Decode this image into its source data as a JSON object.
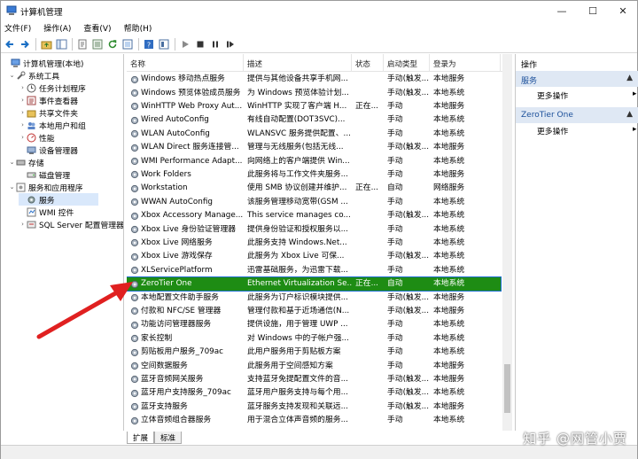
{
  "window": {
    "title": "计算机管理",
    "min_glyph": "—",
    "max_glyph": "☐",
    "close_glyph": "✕"
  },
  "menu": [
    "文件(F)",
    "操作(A)",
    "查看(V)",
    "帮助(H)"
  ],
  "tree": {
    "root": "计算机管理(本地)",
    "system_tools": "系统工具",
    "task_scheduler": "任务计划程序",
    "event_viewer": "事件查看器",
    "shared_folders": "共享文件夹",
    "local_users": "本地用户和组",
    "performance": "性能",
    "device_manager": "设备管理器",
    "storage": "存储",
    "disk_management": "磁盘管理",
    "services_apps": "服务和应用程序",
    "services": "服务",
    "wmi": "WMI 控件",
    "sql": "SQL Server 配置管理器"
  },
  "columns": {
    "name": "名称",
    "desc": "描述",
    "status": "状态",
    "startup": "启动类型",
    "logon": "登录为"
  },
  "rows": [
    {
      "name": "Windows 移动热点服务",
      "desc": "提供与其他设备共享手机网...",
      "status": "",
      "startup": "手动(触发...",
      "logon": "本地服务"
    },
    {
      "name": "Windows 预览体验成员服务",
      "desc": "为 Windows 预览体验计划...",
      "status": "",
      "startup": "手动(触发...",
      "logon": "本地系统"
    },
    {
      "name": "WinHTTP Web Proxy Aut...",
      "desc": "WinHTTP 实现了客户端 H...",
      "status": "正在...",
      "startup": "手动",
      "logon": "本地服务"
    },
    {
      "name": "Wired AutoConfig",
      "desc": "有线自动配置(DOT3SVC)...",
      "status": "",
      "startup": "手动",
      "logon": "本地系统"
    },
    {
      "name": "WLAN AutoConfig",
      "desc": "WLANSVC 服务提供配置、...",
      "status": "",
      "startup": "手动",
      "logon": "本地系统"
    },
    {
      "name": "WLAN Direct 服务连接管...",
      "desc": "管理与无线服务(包括无线...",
      "status": "",
      "startup": "手动(触发...",
      "logon": "本地服务"
    },
    {
      "name": "WMI Performance Adapt...",
      "desc": "向网络上的客户端提供 Win...",
      "status": "",
      "startup": "手动",
      "logon": "本地系统"
    },
    {
      "name": "Work Folders",
      "desc": "此服务将与工作文件夹服务...",
      "status": "",
      "startup": "手动",
      "logon": "本地服务"
    },
    {
      "name": "Workstation",
      "desc": "使用 SMB 协议创建并维护...",
      "status": "正在...",
      "startup": "自动",
      "logon": "网络服务"
    },
    {
      "name": "WWAN AutoConfig",
      "desc": "该服务管理移动宽带(GSM ...",
      "status": "",
      "startup": "手动",
      "logon": "本地系统"
    },
    {
      "name": "Xbox Accessory Manage...",
      "desc": "This service manages co...",
      "status": "",
      "startup": "手动(触发...",
      "logon": "本地系统"
    },
    {
      "name": "Xbox Live 身份验证管理器",
      "desc": "提供身份验证和授权服务以...",
      "status": "",
      "startup": "手动",
      "logon": "本地系统"
    },
    {
      "name": "Xbox Live 网络服务",
      "desc": "此服务支持 Windows.Net...",
      "status": "",
      "startup": "手动",
      "logon": "本地系统"
    },
    {
      "name": "Xbox Live 游戏保存",
      "desc": "此服务为 Xbox Live 可保...",
      "status": "",
      "startup": "手动(触发...",
      "logon": "本地系统"
    },
    {
      "name": "XLServicePlatform",
      "desc": "迅雷基础服务，为迅雷下载...",
      "status": "",
      "startup": "手动",
      "logon": "本地系统"
    },
    {
      "name": "ZeroTier One",
      "desc": "Ethernet Virtualization Se...",
      "status": "正在...",
      "startup": "自动",
      "logon": "本地系统"
    },
    {
      "name": "本地配置文件助手服务",
      "desc": "此服务为订户标识模块提供...",
      "status": "",
      "startup": "手动(触发...",
      "logon": "本地服务"
    },
    {
      "name": "付款和 NFC/SE 管理器",
      "desc": "管理付款和基于近场通信(N...",
      "status": "",
      "startup": "手动(触发...",
      "logon": "本地服务"
    },
    {
      "name": "功能访问管理器服务",
      "desc": "提供设施，用于管理 UWP ...",
      "status": "",
      "startup": "手动",
      "logon": "本地系统"
    },
    {
      "name": "家长控制",
      "desc": "对 Windows 中的子帐户强...",
      "status": "",
      "startup": "手动",
      "logon": "本地系统"
    },
    {
      "name": "剪贴板用户服务_709ac",
      "desc": "此用户服务用于剪贴板方案",
      "status": "",
      "startup": "手动",
      "logon": "本地系统"
    },
    {
      "name": "空间数据服务",
      "desc": "此服务用于空间感知方案",
      "status": "",
      "startup": "手动",
      "logon": "本地服务"
    },
    {
      "name": "蓝牙音频网关服务",
      "desc": "支持蓝牙免提配置文件的音...",
      "status": "",
      "startup": "手动(触发...",
      "logon": "本地服务"
    },
    {
      "name": "蓝牙用户支持服务_709ac",
      "desc": "蓝牙用户服务支持与每个用...",
      "status": "",
      "startup": "手动(触发...",
      "logon": "本地系统"
    },
    {
      "name": "蓝牙支持服务",
      "desc": "蓝牙服务支持发现和关联远...",
      "status": "",
      "startup": "手动(触发...",
      "logon": "本地服务"
    },
    {
      "name": "立体音频组合器服务",
      "desc": "用于混合立体声音频的服务...",
      "status": "",
      "startup": "手动",
      "logon": "本地系统"
    }
  ],
  "tabs": [
    "扩展",
    "标准"
  ],
  "actions": {
    "header": "操作",
    "section1": "服务",
    "section1_more": "更多操作",
    "section2": "ZeroTier One",
    "section2_more": "更多操作"
  },
  "watermark": "知乎 @网管小贾",
  "colors": {
    "highlight": "#1e8c14",
    "arrow": "#e02020",
    "action_header_bg": "#dfe8f4"
  }
}
